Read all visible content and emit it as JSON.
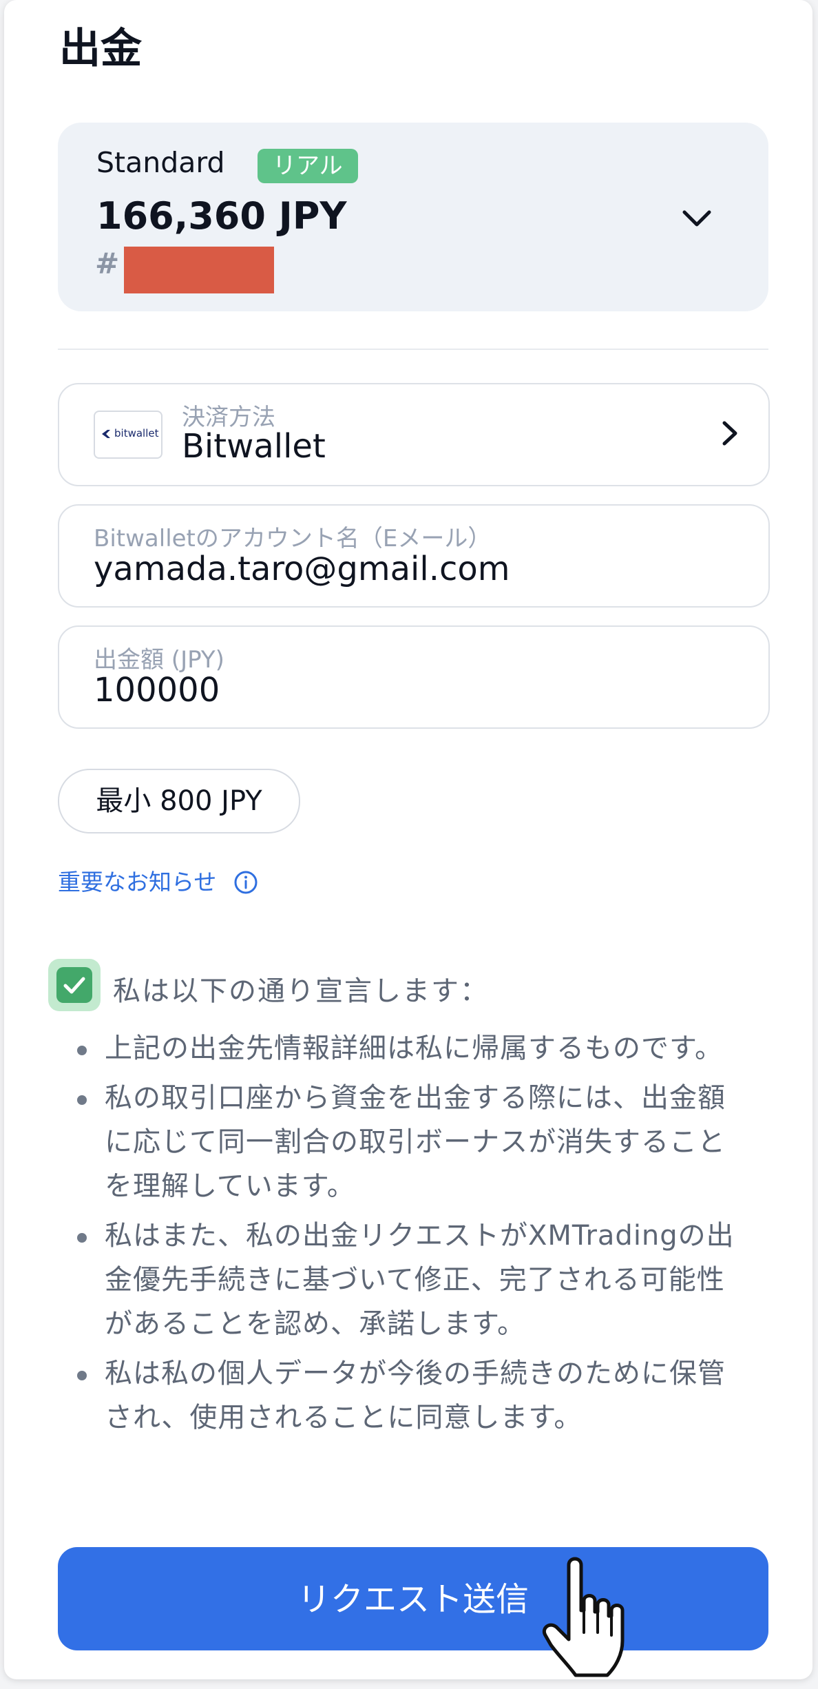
{
  "page": {
    "title": "出金"
  },
  "account": {
    "type": "Standard",
    "badge": "リアル",
    "balance": "166,360 JPY",
    "number_prefix": "#"
  },
  "payment_method": {
    "label": "決済方法",
    "value": "Bitwallet",
    "logo_text": "bitwallet"
  },
  "email_field": {
    "label": "Bitwalletのアカウント名（Eメール）",
    "value": "yamada.taro@gmail.com"
  },
  "amount_field": {
    "label": "出金額 (JPY)",
    "value": "100000"
  },
  "min_amount": "最小 800 JPY",
  "notice_link": "重要なお知らせ",
  "declaration": {
    "checked": true,
    "label": "私は以下の通り宣言します：",
    "items": [
      "上記の出金先情報詳細は私に帰属するものです。",
      "私の取引口座から資金を出金する際には、出金額に応じて同一割合の取引ボーナスが消失することを理解しています。",
      "私はまた、私の出金リクエストがXMTradingの出金優先手続きに基づいて修正、完了される可能性があることを認め、承諾します。",
      "私は私の個人データが今後の手続きのために保管され、使用されることに同意します。"
    ]
  },
  "submit_label": "リクエスト送信",
  "colors": {
    "accent": "#3270e6",
    "badge": "#5fc38a",
    "checkbox": "#43a86a",
    "redaction": "#d95b45"
  },
  "icons": [
    "chevron-down-icon",
    "chevron-right-icon",
    "info-icon",
    "check-icon",
    "hand-pointer-icon"
  ]
}
